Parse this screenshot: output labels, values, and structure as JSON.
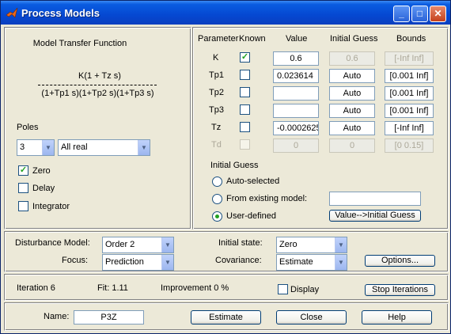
{
  "window": {
    "title": "Process Models"
  },
  "tf": {
    "heading": "Model Transfer Function",
    "numerator": "K(1 + Tz s)",
    "denominator": "(1+Tp1 s)(1+Tp2 s)(1+Tp3 s)"
  },
  "poles": {
    "label": "Poles",
    "count": "3",
    "type": "All real"
  },
  "options": {
    "zero": {
      "label": "Zero",
      "checked": true
    },
    "delay": {
      "label": "Delay",
      "checked": false
    },
    "integrator": {
      "label": "Integrator",
      "checked": false
    }
  },
  "params": {
    "headers": {
      "parameter": "Parameter",
      "known": "Known",
      "value": "Value",
      "initial_guess": "Initial Guess",
      "bounds": "Bounds"
    },
    "rows": [
      {
        "name": "K",
        "known": true,
        "value": "0.6",
        "guess": "0.6",
        "bounds": "[-Inf Inf]",
        "disabled_guess": true,
        "disabled_bounds": true
      },
      {
        "name": "Tp1",
        "known": false,
        "value": "0.023614",
        "guess": "Auto",
        "bounds": "[0.001 Inf]"
      },
      {
        "name": "Tp2",
        "known": false,
        "value": "",
        "guess": "Auto",
        "bounds": "[0.001 Inf]"
      },
      {
        "name": "Tp3",
        "known": false,
        "value": "",
        "guess": "Auto",
        "bounds": "[0.001 Inf]"
      },
      {
        "name": "Tz",
        "known": false,
        "value": "-0.0002625",
        "guess": "Auto",
        "bounds": "[-Inf Inf]"
      },
      {
        "name": "Td",
        "known": false,
        "value": "0",
        "guess": "0",
        "bounds": "[0 0.15]",
        "disabled": true
      }
    ]
  },
  "initial_guess": {
    "label": "Initial Guess",
    "auto_selected": "Auto-selected",
    "from_existing": "From existing model:",
    "existing_value": "",
    "user_defined": "User-defined",
    "selected": "user_defined",
    "value_button": "Value-->Initial Guess"
  },
  "disturbance": {
    "label": "Disturbance Model:",
    "value": "Order 2",
    "focus_label": "Focus:",
    "focus_value": "Prediction",
    "initial_state_label": "Initial state:",
    "initial_state_value": "Zero",
    "covariance_label": "Covariance:",
    "covariance_value": "Estimate",
    "options_button": "Options..."
  },
  "status": {
    "iteration": "Iteration 6",
    "fit": "Fit: 1.11",
    "improvement": "Improvement 0 %",
    "display_label": "Display",
    "display_checked": false,
    "stop_button": "Stop Iterations"
  },
  "bottom": {
    "name_label": "Name:",
    "name_value": "P3Z",
    "estimate_button": "Estimate",
    "close_button": "Close",
    "help_button": "Help"
  }
}
